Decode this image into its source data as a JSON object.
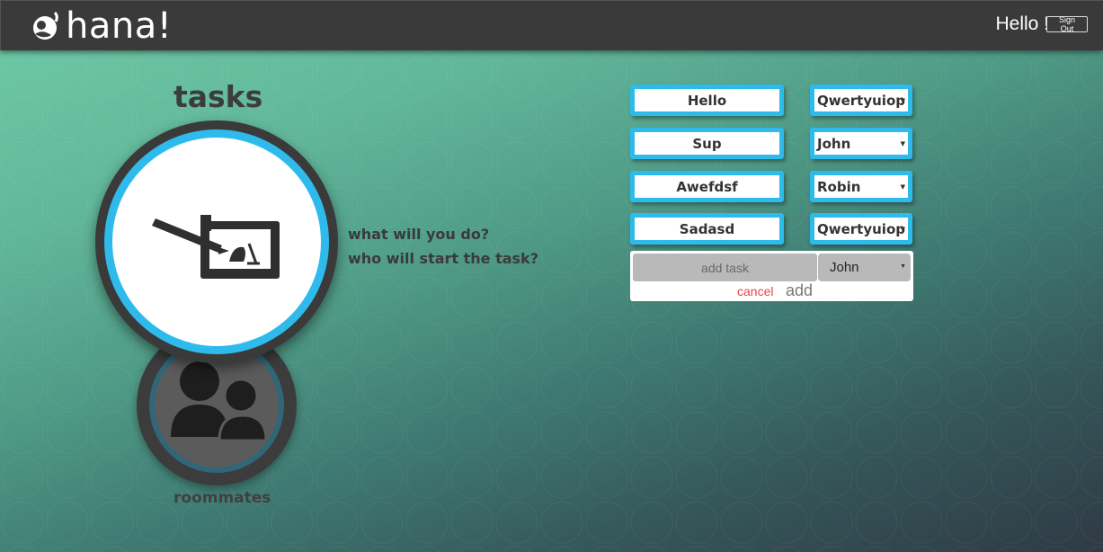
{
  "header": {
    "logo_text": "hana!",
    "greeting": "Hello !",
    "signout_label": "Sign Out"
  },
  "nav": {
    "tasks_title": "tasks",
    "roommates_label": "roommates"
  },
  "prompts": {
    "line1": "what will you do?",
    "line2": "who will start the task?"
  },
  "tasks": [
    {
      "name": "Hello",
      "assignee": "Qwertyuiop"
    },
    {
      "name": "Sup",
      "assignee": "John"
    },
    {
      "name": "Awefdsf",
      "assignee": "Robin"
    },
    {
      "name": "Sadasd",
      "assignee": "Qwertyuiop"
    }
  ],
  "add_form": {
    "placeholder": "add task",
    "selected_assignee": "John",
    "cancel_label": "cancel",
    "add_label": "add"
  },
  "colors": {
    "accent": "#2ebbec",
    "topbar": "#3a3a3a",
    "cancel": "#e04848"
  }
}
